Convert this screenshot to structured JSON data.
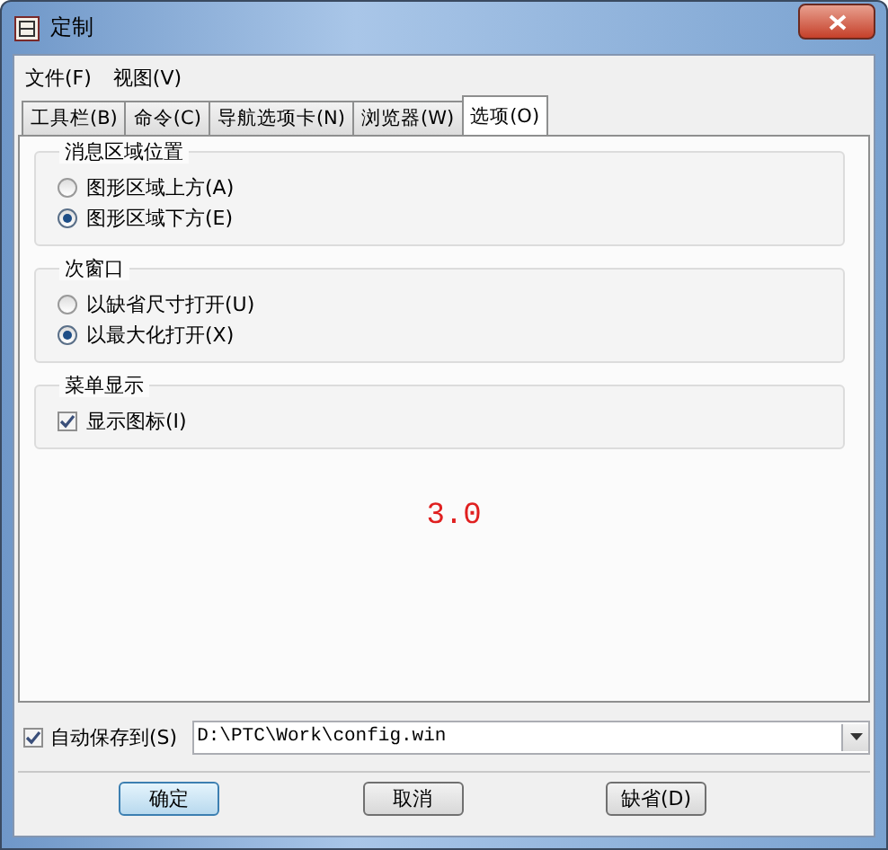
{
  "window": {
    "title": "定制"
  },
  "menu": [
    "文件(F)",
    "视图(V)"
  ],
  "tabs": [
    {
      "label": "工具栏(B)",
      "selected": false
    },
    {
      "label": "命令(C)",
      "selected": false
    },
    {
      "label": "导航选项卡(N)",
      "selected": false
    },
    {
      "label": "浏览器(W)",
      "selected": false
    },
    {
      "label": "选项(O)",
      "selected": true
    }
  ],
  "groups": [
    {
      "title": "消息区域位置",
      "items": [
        {
          "kind": "radio",
          "label": "图形区域上方(A)",
          "selected": false
        },
        {
          "kind": "radio",
          "label": "图形区域下方(E)",
          "selected": true
        }
      ]
    },
    {
      "title": "次窗口",
      "items": [
        {
          "kind": "radio",
          "label": "以缺省尺寸打开(U)",
          "selected": false
        },
        {
          "kind": "radio",
          "label": "以最大化打开(X)",
          "selected": true
        }
      ]
    },
    {
      "title": "菜单显示",
      "items": [
        {
          "kind": "checkbox",
          "label": "显示图标(I)",
          "checked": true
        }
      ]
    }
  ],
  "annotation": "3.0",
  "autosave": {
    "label": "自动保存到(S)",
    "checked": true,
    "value": "D:\\PTC\\Work\\config.win"
  },
  "buttons": [
    {
      "label": "确定",
      "default": true
    },
    {
      "label": "取消",
      "default": false
    },
    {
      "label": "缺省(D)",
      "default": false
    }
  ]
}
